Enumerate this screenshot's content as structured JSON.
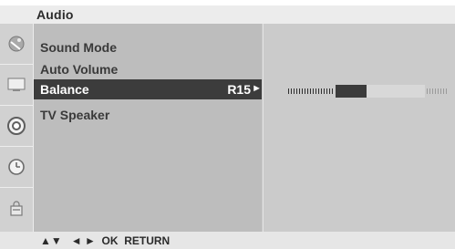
{
  "title": "Audio",
  "menu": {
    "items": [
      {
        "label": "Sound Mode"
      },
      {
        "label": "Auto Volume"
      },
      {
        "label": "Balance",
        "value": "R15",
        "arrow": "►"
      },
      {
        "label": "TV Speaker"
      }
    ],
    "selected_index": 2
  },
  "balance": {
    "value_label": "R15",
    "value": 15,
    "range": [
      -50,
      50
    ]
  },
  "sidebar_icons": [
    {
      "name": "satellite-dish-icon"
    },
    {
      "name": "tv-screen-icon"
    },
    {
      "name": "speaker-icon"
    },
    {
      "name": "clock-icon"
    },
    {
      "name": "lock-icon"
    }
  ],
  "footer": {
    "nav_up_down": "▲▼",
    "nav_left_right": "◄ ►",
    "ok": "OK",
    "return": "RETURN"
  },
  "colors": {
    "panel": "#c9c9c9",
    "menu_bg": "#bdbdbd",
    "selected_bg": "#3c3c3c",
    "bar_dark": "#3b3b3b",
    "bar_light": "#d8d8d8"
  }
}
